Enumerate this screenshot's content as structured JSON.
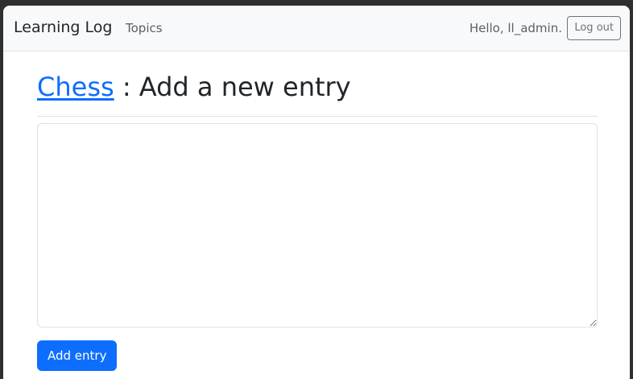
{
  "navbar": {
    "brand": "Learning Log",
    "topics_link": "Topics",
    "greeting": "Hello, ll_admin.",
    "logout_label": "Log out"
  },
  "page": {
    "topic_link": "Chess",
    "title_suffix": ": Add a new entry"
  },
  "form": {
    "entry_text": "",
    "submit_label": "Add entry"
  },
  "colors": {
    "accent": "#0d6efd",
    "navbar_bg": "#f8f9fa"
  }
}
